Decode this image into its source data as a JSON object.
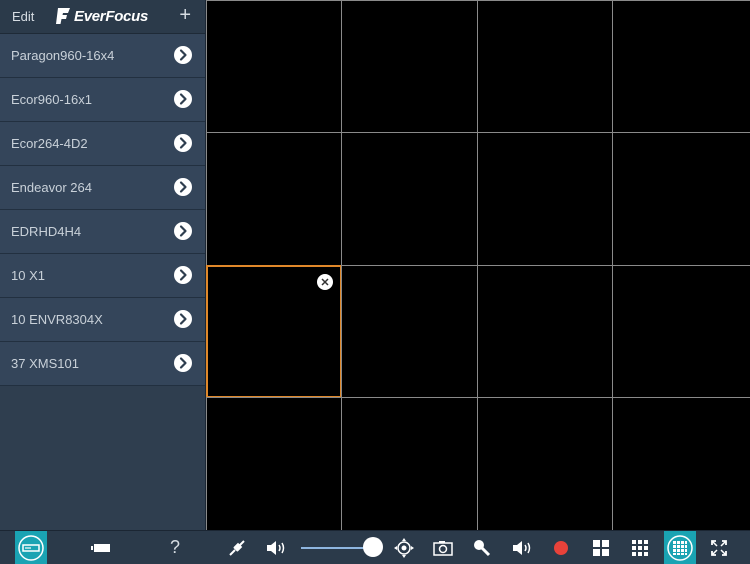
{
  "header": {
    "edit_label": "Edit",
    "logo_text": "EverFocus",
    "add_label": "+"
  },
  "devices": [
    {
      "label": "Paragon960-16x4"
    },
    {
      "label": "Ecor960-16x1"
    },
    {
      "label": "Ecor264-4D2"
    },
    {
      "label": "Endeavor 264"
    },
    {
      "label": "EDRHD4H4"
    },
    {
      "label": "10 X1"
    },
    {
      "label": "10 ENVR8304X"
    },
    {
      "label": "37 XMS101"
    }
  ],
  "grid": {
    "rows": 4,
    "cols": 4,
    "selected_cell": [
      2,
      0
    ]
  },
  "bottombar": {
    "help_label": "?",
    "volume_level": 1.0,
    "icons": [
      "dvr-icon",
      "battery-icon",
      "help-icon",
      "disconnect-icon",
      "speaker-icon",
      "ptz-icon",
      "snapshot-icon",
      "microphone-icon",
      "audio-icon",
      "record-icon",
      "layout-2x2-icon",
      "layout-3x3-icon",
      "layout-4x4-icon",
      "fullscreen-icon"
    ]
  },
  "colors": {
    "accent_teal": "#1aa3b3",
    "selected_border": "#e0882a",
    "record_red": "#e8423a"
  }
}
